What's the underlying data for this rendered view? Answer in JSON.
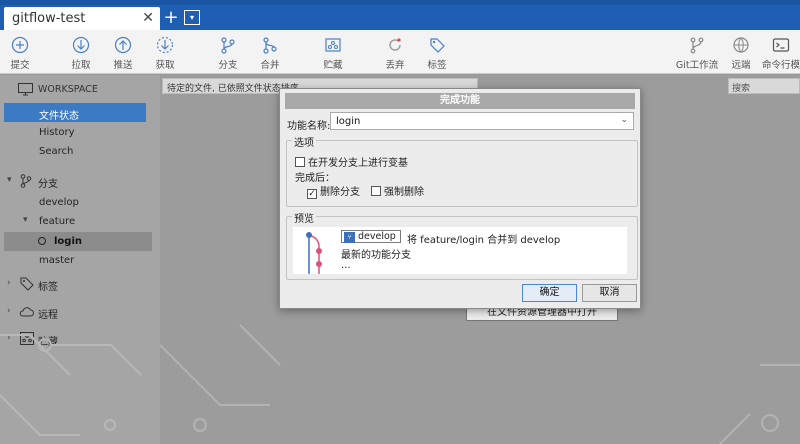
{
  "tab": {
    "title": "gitflow-test",
    "close": "✕",
    "new": "+",
    "menu": "▾"
  },
  "toolbar": {
    "items": [
      {
        "label": "提交",
        "icon": "plus-circle-icon"
      },
      {
        "label": "拉取",
        "icon": "arrow-down-circle-icon"
      },
      {
        "label": "推送",
        "icon": "arrow-up-circle-icon"
      },
      {
        "label": "获取",
        "icon": "dashed-download-icon"
      },
      {
        "label": "分支",
        "icon": "branch-icon"
      },
      {
        "label": "合并",
        "icon": "merge-icon"
      },
      {
        "label": "贮藏",
        "icon": "stash-icon"
      },
      {
        "label": "丢弃",
        "icon": "discard-icon"
      },
      {
        "label": "标签",
        "icon": "tag-icon"
      },
      {
        "label": "Git工作流",
        "icon": "gitflow-icon"
      },
      {
        "label": "远端",
        "icon": "globe-icon"
      },
      {
        "label": "命令行模",
        "icon": "terminal-icon"
      }
    ]
  },
  "sidebar": {
    "workspace": "WORKSPACE",
    "workspace_items": [
      "文件状态",
      "History",
      "Search"
    ],
    "branches_label": "分支",
    "branches": [
      "develop",
      "feature",
      "login",
      "master"
    ],
    "tags_label": "标签",
    "remotes_label": "远程",
    "stash_label": "贮藏"
  },
  "main": {
    "filter": "待定的文件, 已依照文件状态排序",
    "search_placeholder": "搜索",
    "open_explorer": "在文件资源管理器中打开"
  },
  "dialog": {
    "title": "完成功能",
    "feature_name_label": "功能名称:",
    "feature_name_value": "login",
    "options_title": "选项",
    "rebase_option": "在开发分支上进行变基",
    "after_label": "完成后：",
    "delete_branch": "删除分支",
    "force_delete": "强制删除",
    "preview_title": "预览",
    "preview_branch": "develop",
    "preview_merge_text": "将 feature/login 合并到 develop",
    "preview_line2": "最新的功能分支",
    "preview_line3": "...",
    "ok": "确定",
    "cancel": "取消",
    "colors": {
      "accent": "#3d6fbf",
      "graph_pink": "#e0517a",
      "graph_blue": "#3d6fbf"
    }
  }
}
